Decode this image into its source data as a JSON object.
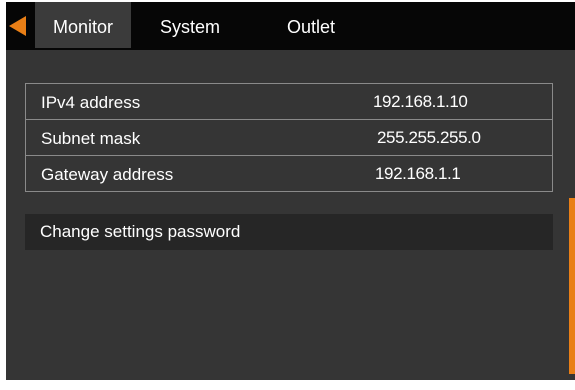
{
  "colors": {
    "accent": "#e97f16",
    "background": "#353535",
    "topbar": "#060606",
    "active_tab": "#3b3b3b",
    "row_border": "#8a8a8a",
    "text": "#ffffff"
  },
  "header": {
    "back_icon": "left-triangle-icon",
    "tabs": [
      {
        "label": "Monitor",
        "active": true
      },
      {
        "label": "System",
        "active": false
      },
      {
        "label": "Outlet",
        "active": false
      }
    ]
  },
  "network_settings": {
    "rows": [
      {
        "label": "IPv4 address",
        "value": "192.168.1.10"
      },
      {
        "label": "Subnet mask",
        "value": "255.255.255.0"
      },
      {
        "label": "Gateway address",
        "value": "192.168.1.1"
      }
    ],
    "change_password_label": "Change settings password"
  }
}
